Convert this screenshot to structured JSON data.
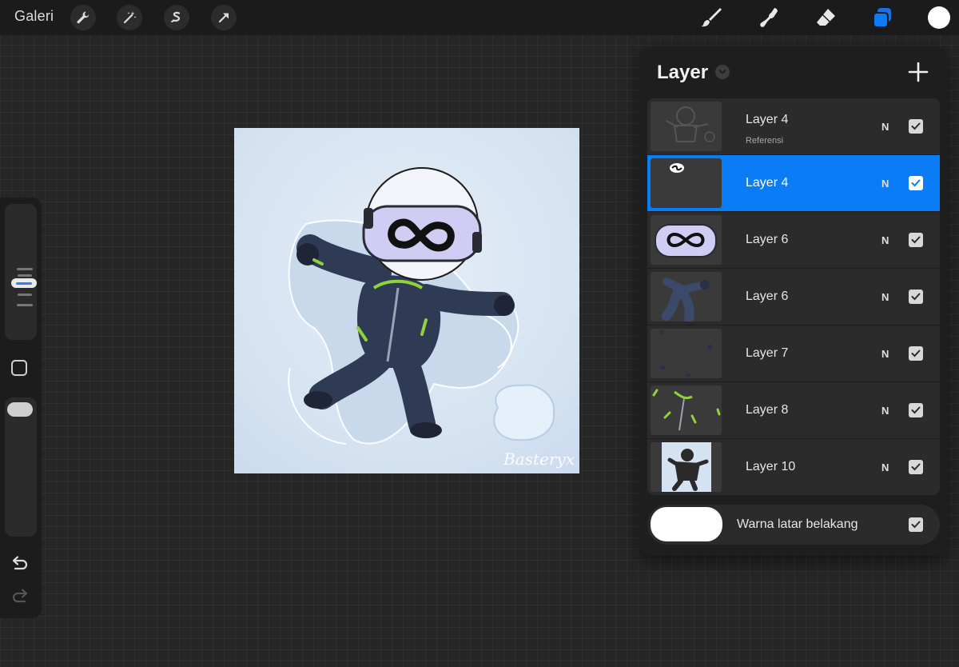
{
  "topbar": {
    "gallery_label": "Galeri",
    "left_tools": [
      "wrench-icon",
      "magic-wand-icon",
      "selection-icon",
      "transform-arrow-icon"
    ],
    "right_tools": [
      "brush-icon",
      "smudge-icon",
      "eraser-icon",
      "layers-icon"
    ],
    "active_tool": "layers-icon",
    "current_color": "#ffffff"
  },
  "sidebar": {
    "controls": [
      "brush-size-slider",
      "modify-button",
      "opacity-slider",
      "undo-icon",
      "redo-icon"
    ]
  },
  "canvas": {
    "signature": "Basteryx",
    "background_color": "#d8e5f2"
  },
  "layers_panel": {
    "title": "Layer",
    "add_icon": "plus-icon",
    "layers": [
      {
        "name": "Layer 4",
        "sub": "Referensi",
        "blend": "N",
        "visible": true,
        "selected": false
      },
      {
        "name": "Layer 4",
        "sub": "",
        "blend": "N",
        "visible": true,
        "selected": true
      },
      {
        "name": "Layer 6",
        "sub": "",
        "blend": "N",
        "visible": true,
        "selected": false
      },
      {
        "name": "Layer 6",
        "sub": "",
        "blend": "N",
        "visible": true,
        "selected": false
      },
      {
        "name": "Layer 7",
        "sub": "",
        "blend": "N",
        "visible": true,
        "selected": false
      },
      {
        "name": "Layer 8",
        "sub": "",
        "blend": "N",
        "visible": true,
        "selected": false
      },
      {
        "name": "Layer 10",
        "sub": "",
        "blend": "N",
        "visible": true,
        "selected": false
      }
    ],
    "background": {
      "label": "Warna latar belakang",
      "color": "#ffffff",
      "visible": true
    }
  },
  "colors": {
    "accent": "#0a7cf5",
    "panel": "#1e1e1e",
    "row": "#2b2b2b"
  }
}
